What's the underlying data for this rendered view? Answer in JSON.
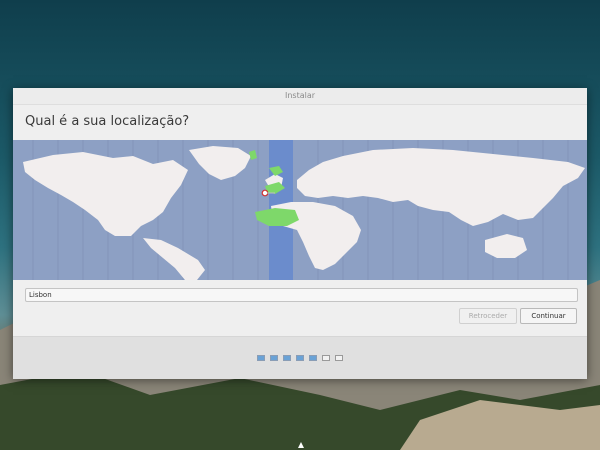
{
  "window": {
    "title": "Instalar"
  },
  "page": {
    "heading": "Qual é a sua localização?"
  },
  "timezone_map": {
    "selected_city": "Lisbon"
  },
  "location_input": {
    "value": "Lisbon"
  },
  "buttons": {
    "back": "Retroceder",
    "next": "Continuar"
  },
  "progress": {
    "total_steps": 7,
    "completed_steps": 5
  }
}
